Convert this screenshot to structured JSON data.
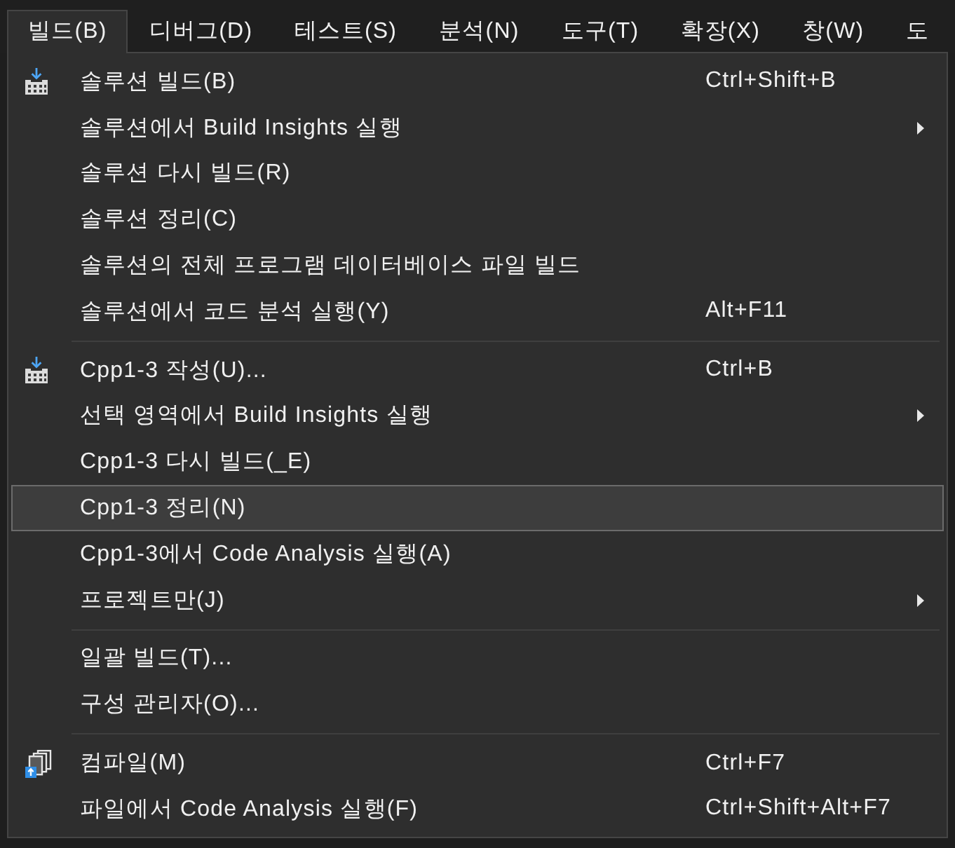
{
  "menu_bar": {
    "items": [
      {
        "label": "빌드(B)",
        "selected": true
      },
      {
        "label": "디버그(D)",
        "selected": false
      },
      {
        "label": "테스트(S)",
        "selected": false
      },
      {
        "label": "분석(N)",
        "selected": false
      },
      {
        "label": "도구(T)",
        "selected": false
      },
      {
        "label": "확장(X)",
        "selected": false
      },
      {
        "label": "창(W)",
        "selected": false
      },
      {
        "label": "도",
        "selected": false
      }
    ]
  },
  "dropdown": {
    "sections": [
      {
        "items": [
          {
            "kind": "build",
            "label": "솔루션 빌드(B)",
            "shortcut": "Ctrl+Shift+B",
            "submenu": false,
            "selected": false
          },
          {
            "kind": "plain",
            "label": "솔루션에서 Build Insights 실행",
            "submenu": true,
            "selected": false
          },
          {
            "kind": "plain",
            "label": "솔루션 다시 빌드(R)",
            "submenu": false,
            "selected": false
          },
          {
            "kind": "plain",
            "label": "솔루션 정리(C)",
            "submenu": false,
            "selected": false
          },
          {
            "kind": "plain",
            "label": "솔루션의 전체 프로그램 데이터베이스 파일 빌드",
            "submenu": false,
            "selected": false
          },
          {
            "kind": "plain",
            "label": "솔루션에서 코드 분석 실행(Y)",
            "shortcut": "Alt+F11",
            "submenu": false,
            "selected": false
          }
        ]
      },
      {
        "items": [
          {
            "kind": "build",
            "label": "Cpp1-3 작성(U)...",
            "shortcut": "Ctrl+B",
            "submenu": false,
            "selected": false
          },
          {
            "kind": "plain",
            "label": "선택 영역에서 Build Insights 실행",
            "submenu": true,
            "selected": false
          },
          {
            "kind": "plain",
            "label": "Cpp1-3 다시 빌드(_E)",
            "submenu": false,
            "selected": false
          },
          {
            "kind": "plain",
            "label": "Cpp1-3 정리(N)",
            "submenu": false,
            "selected": true
          },
          {
            "kind": "plain",
            "label": "Cpp1-3에서 Code Analysis 실행(A)",
            "submenu": false,
            "selected": false
          },
          {
            "kind": "plain",
            "label": "프로젝트만(J)",
            "submenu": true,
            "selected": false
          }
        ]
      },
      {
        "items": [
          {
            "kind": "plain",
            "label": "일괄 빌드(T)...",
            "submenu": false,
            "selected": false
          },
          {
            "kind": "plain",
            "label": "구성 관리자(O)...",
            "submenu": false,
            "selected": false
          }
        ]
      },
      {
        "items": [
          {
            "kind": "compile",
            "label": "컴파일(M)",
            "shortcut": "Ctrl+F7",
            "submenu": false,
            "selected": false
          },
          {
            "kind": "plain",
            "label": "파일에서 Code Analysis 실행(F)",
            "shortcut": "Ctrl+Shift+Alt+F7",
            "submenu": false,
            "selected": false
          }
        ]
      }
    ]
  }
}
